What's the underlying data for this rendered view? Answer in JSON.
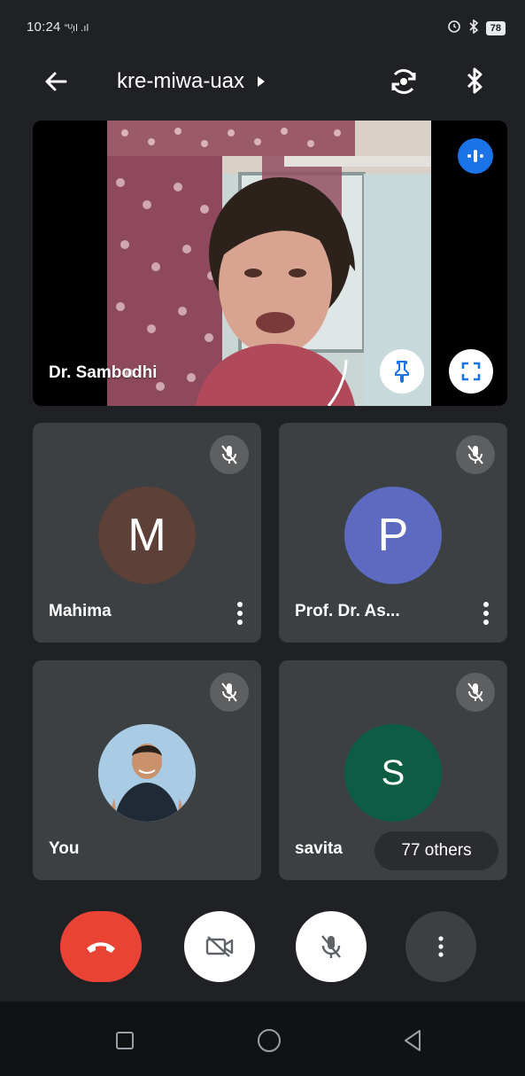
{
  "status_bar": {
    "time": "10:24",
    "signal_text": "\"ᵁ᷊ıl .ıl",
    "battery": "78",
    "icons": [
      "signal-icon",
      "alarm-icon",
      "bluetooth-icon",
      "battery-icon"
    ]
  },
  "header": {
    "meeting_code": "kre-miwa-uax",
    "icons": [
      "back-arrow-icon",
      "caret-right-icon",
      "switch-camera-icon",
      "bluetooth-audio-icon"
    ]
  },
  "main_speaker": {
    "name": "Dr. Sambodhi",
    "icons": [
      "speaking-indicator-icon",
      "pin-icon",
      "fullscreen-icon"
    ]
  },
  "participants": [
    {
      "name": "Mahima",
      "initial": "M",
      "avatar_color": "#5d4037",
      "muted": true
    },
    {
      "name": "Prof. Dr. As...",
      "initial": "P",
      "avatar_color": "#5c6bc0",
      "muted": true
    },
    {
      "name": "You",
      "initial": "",
      "avatar_color": "#9fc3e0",
      "muted": true,
      "is_photo": true
    },
    {
      "name": "savita",
      "initial": "S",
      "avatar_color": "#0d5d44",
      "muted": true
    }
  ],
  "others_chip": "77 others",
  "controls": {
    "hangup_color": "#ea4335",
    "icons": [
      "hang-up-icon",
      "camera-off-icon",
      "mic-off-icon",
      "more-options-icon"
    ]
  },
  "nav": {
    "icons": [
      "recents-icon",
      "home-icon",
      "back-icon"
    ]
  }
}
